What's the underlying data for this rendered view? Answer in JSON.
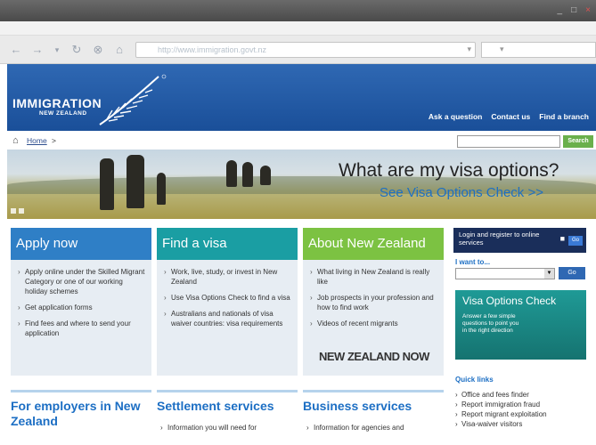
{
  "browser": {
    "window_controls": [
      "_",
      "□",
      "×"
    ],
    "address_url": "http://www.immigration.govt.nz"
  },
  "header": {
    "logo_text": "IMMIGRATION",
    "logo_sub": "NEW ZEALAND",
    "links": [
      "Ask a question",
      "Contact us",
      "Find a branch"
    ]
  },
  "breadcrumb": {
    "home": "Home",
    "sep": ">"
  },
  "search": {
    "button": "Search"
  },
  "hero": {
    "title": "What are my visa options?",
    "link": "See Visa Options Check >>"
  },
  "cards": [
    {
      "title": "Apply now",
      "color": "#2f7fc6",
      "items": [
        "Apply online under the Skilled Migrant Category or one of our working holiday schemes",
        "Get application forms",
        "Find fees and where to send your application"
      ]
    },
    {
      "title": "Find a visa",
      "color": "#1a9ea3",
      "items": [
        "Work, live, study, or invest in New Zealand",
        "Use Visa Options Check to find a visa",
        "Australians and nationals of visa waiver countries: visa requirements"
      ]
    },
    {
      "title": "About New Zealand",
      "color": "#7cc242",
      "items": [
        "What living in New Zealand is really like",
        "Job prospects in your profession and how to find work",
        "Videos of recent migrants"
      ]
    }
  ],
  "nz_now": "NEW ZEALAND NOW",
  "sidebar": {
    "login": "Login and register to online services",
    "login_go": "Go",
    "want_label": "I want to...",
    "want_go": "Go",
    "visa_title": "Visa Options Check",
    "visa_desc": "Answer a few simple questions to point you in the right direction",
    "quick_title": "Quick links",
    "quick_links": [
      "Office and fees finder",
      "Report immigration fraud",
      "Report migrant exploitation",
      "Visa-waiver visitors"
    ]
  },
  "bottom": [
    {
      "title": "For employers in New Zealand",
      "text": ""
    },
    {
      "title": "Settlement services",
      "text": "Information you will need for"
    },
    {
      "title": "Business services",
      "text": "Information for agencies and"
    }
  ]
}
